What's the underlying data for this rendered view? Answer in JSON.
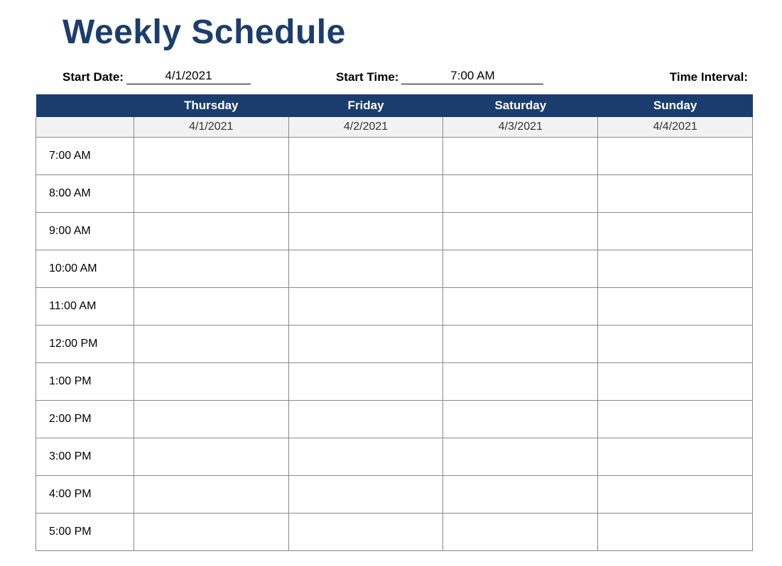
{
  "title": "Weekly Schedule",
  "meta": {
    "start_date_label": "Start Date:",
    "start_date_value": "4/1/2021",
    "start_time_label": "Start Time:",
    "start_time_value": "7:00 AM",
    "time_interval_label": "Time Interval:"
  },
  "colors": {
    "header_bg": "#1b3d6d",
    "header_text": "#ffffff",
    "date_row_bg": "#f2f2f2",
    "border": "#8a8a8a"
  },
  "days": [
    {
      "name": "Thursday",
      "date": "4/1/2021"
    },
    {
      "name": "Friday",
      "date": "4/2/2021"
    },
    {
      "name": "Saturday",
      "date": "4/3/2021"
    },
    {
      "name": "Sunday",
      "date": "4/4/2021"
    }
  ],
  "times": [
    "7:00 AM",
    "8:00 AM",
    "9:00 AM",
    "10:00 AM",
    "11:00 AM",
    "12:00 PM",
    "1:00 PM",
    "2:00 PM",
    "3:00 PM",
    "4:00 PM",
    "5:00 PM"
  ]
}
